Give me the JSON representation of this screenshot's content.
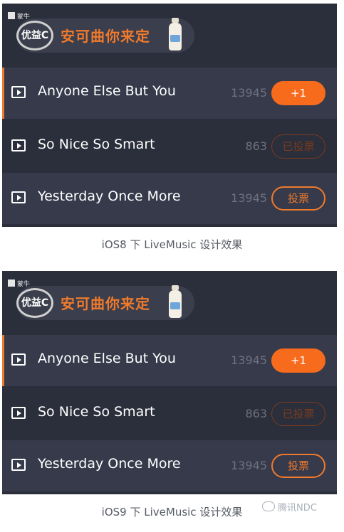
{
  "brand": "蒙牛",
  "logo": "优益C",
  "slogan": "安可曲你来定",
  "songs": [
    {
      "title": "Anyone Else But You",
      "count": "13945",
      "button": "+1"
    },
    {
      "title": "So Nice So Smart",
      "count": "863",
      "button": "已投票"
    },
    {
      "title": "Yesterday Once More",
      "count": "13945",
      "button": "投票"
    }
  ],
  "captions": [
    "iOS8 下 LiveMusic 设计效果",
    "iOS9 下 LiveMusic 设计效果"
  ],
  "watermark": "腾讯NDC",
  "colors": {
    "accent": "#f07a2c",
    "panel": "#2b2e3b"
  },
  "icons": [
    "play-icon",
    "bottle-icon",
    "wechat-icon"
  ]
}
